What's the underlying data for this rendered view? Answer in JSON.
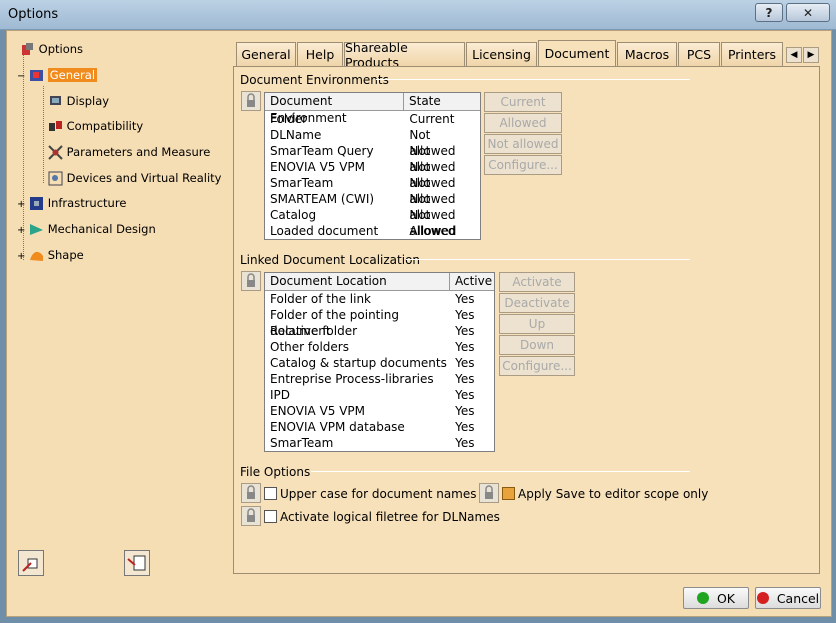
{
  "window": {
    "title": "Options",
    "help_label": "?",
    "close_label": "✕"
  },
  "tree": {
    "root": "Options",
    "items": [
      {
        "label": "General",
        "level": 1,
        "selected": true
      },
      {
        "label": "Display",
        "level": 2
      },
      {
        "label": "Compatibility",
        "level": 2
      },
      {
        "label": "Parameters and Measure",
        "level": 2
      },
      {
        "label": "Devices and Virtual Reality",
        "level": 2
      },
      {
        "label": "Infrastructure",
        "level": 1
      },
      {
        "label": "Mechanical Design",
        "level": 1
      },
      {
        "label": "Shape",
        "level": 1
      }
    ]
  },
  "tabs": [
    "General",
    "Help",
    "Shareable Products",
    "Licensing",
    "Document",
    "Macros",
    "PCS",
    "Printers"
  ],
  "active_tab": "Document",
  "doc_env": {
    "section_label": "Document Environments",
    "col_env": "Document Environment",
    "col_state": "State",
    "rows": [
      [
        "Folder",
        "Current"
      ],
      [
        "DLName",
        "Not allowed"
      ],
      [
        "SmarTeam Query",
        "Not allowed"
      ],
      [
        "ENOVIA V5 VPM",
        "Not allowed"
      ],
      [
        "SmarTeam",
        "Not allowed"
      ],
      [
        "SMARTEAM (CWI)",
        "Not allowed"
      ],
      [
        "Catalog",
        "Not allowed"
      ],
      [
        "Loaded document",
        "Allowed"
      ]
    ],
    "btn_current": "Current",
    "btn_allowed": "Allowed",
    "btn_not_allowed": "Not allowed",
    "btn_configure": "Configure..."
  },
  "linked": {
    "section_label": "Linked Document Localization",
    "col_location": "Document Location",
    "col_active": "Active",
    "rows": [
      [
        "Folder of the link",
        "Yes"
      ],
      [
        "Folder of the pointing document",
        "Yes"
      ],
      [
        "Relative folder",
        "Yes"
      ],
      [
        "Other folders",
        "Yes"
      ],
      [
        "Catalog & startup documents",
        "Yes"
      ],
      [
        "Entreprise Process-libraries",
        "Yes"
      ],
      [
        "IPD",
        "Yes"
      ],
      [
        "ENOVIA V5 VPM",
        "Yes"
      ],
      [
        "ENOVIA VPM  database",
        "Yes"
      ],
      [
        "SmarTeam",
        "Yes"
      ]
    ],
    "btn_activate": "Activate",
    "btn_deactivate": "Deactivate",
    "btn_up": "Up",
    "btn_down": "Down",
    "btn_configure": "Configure..."
  },
  "file_options": {
    "section_label": "File Options",
    "upper_case": {
      "label": "Upper case for document names",
      "checked": false
    },
    "apply_save": {
      "label": "Apply Save to editor scope only",
      "checked": true
    },
    "logical_filetree": {
      "label": "Activate logical filetree for DLNames",
      "checked": false
    }
  },
  "footer": {
    "ok_label": "OK",
    "cancel_label": "Cancel"
  },
  "colors": {
    "selection": "#f08c1e",
    "panel": "#f7e1bb",
    "ok_dot": "#1fa51f",
    "cancel_dot": "#d52020"
  }
}
